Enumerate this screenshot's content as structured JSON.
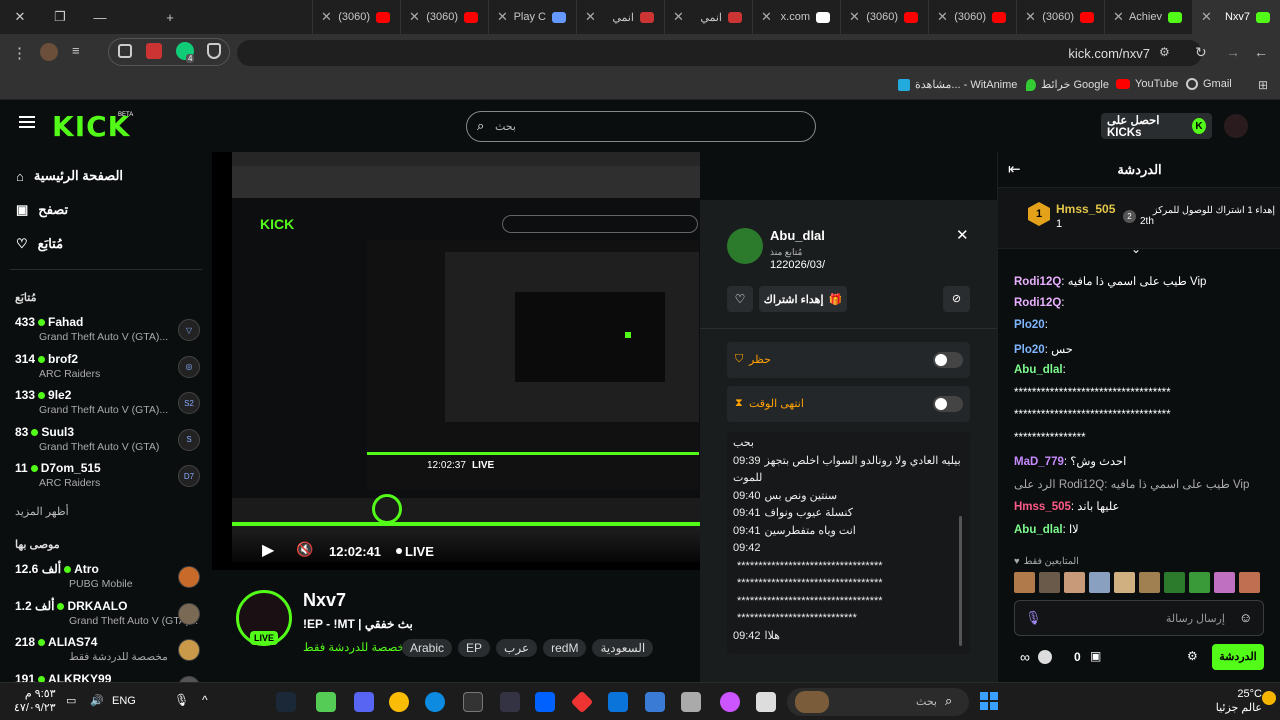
{
  "browser": {
    "tabs": [
      {
        "label": "Nxv7",
        "color": "#53fc18",
        "active": true
      },
      {
        "label": "Achiev",
        "color": "#53fc18"
      },
      {
        "label": "(3060)",
        "color": "#ff0000"
      },
      {
        "label": "(3060)",
        "color": "#ff0000"
      },
      {
        "label": "(3060)",
        "color": "#ff0000"
      },
      {
        "label": "x.com",
        "color": "#ffffff"
      },
      {
        "label": "انمي",
        "color": "#c33"
      },
      {
        "label": "انمي",
        "color": "#c33"
      },
      {
        "label": "Play C",
        "color": "#6699ff"
      },
      {
        "label": "(3060)",
        "color": "#ff0000"
      },
      {
        "label": "(3060)",
        "color": "#ff0000"
      }
    ],
    "url": "kick.com/nxv7",
    "bookmarks": [
      {
        "label": "Gmail",
        "icon": "gmail-icon"
      },
      {
        "label": "YouTube",
        "icon": "youtube-icon"
      },
      {
        "label": "خرائط Google",
        "icon": "maps-icon"
      },
      {
        "label": "مشاهدة... - WitAnime",
        "icon": "witanime-icon"
      }
    ],
    "ext_badge": "4"
  },
  "header": {
    "logo": "KICK",
    "beta": "BETA",
    "search_placeholder": "بحث",
    "get_kicks": "احصل على KICKs"
  },
  "sidebar": {
    "nav": [
      {
        "label": "الصفحة الرئيسية",
        "icon": "home-icon"
      },
      {
        "label": "تصفح",
        "icon": "browse-icon"
      },
      {
        "label": "مُتابَع",
        "icon": "heart-icon"
      }
    ],
    "following_title": "مُتابَع",
    "following": [
      {
        "name": "Fahad",
        "viewers": "433",
        "game": "Grand Theft Auto V (GTA)...",
        "avatar": "▽"
      },
      {
        "name": "brof2",
        "viewers": "314",
        "game": "ARC Raiders",
        "avatar": "◎"
      },
      {
        "name": "9le2",
        "viewers": "133",
        "game": "Grand Theft Auto V (GTA)...",
        "avatar": "S2"
      },
      {
        "name": "Suul3",
        "viewers": "83",
        "game": "Grand Theft Auto V (GTA)",
        "avatar": "S"
      },
      {
        "name": "D7om_515",
        "viewers": "11",
        "game": "ARC Raiders",
        "avatar": "D7"
      }
    ],
    "show_more": "أظهر المزيد",
    "recommended_title": "موصى بها",
    "recommended": [
      {
        "name": "Atro",
        "viewers": "12.6 ألف",
        "game": "PUBG Mobile"
      },
      {
        "name": "DRKAALO",
        "viewers": "1.2 ألف",
        "game": "Grand Theft Auto V (GTA)..."
      },
      {
        "name": "ALIAS74",
        "viewers": "218",
        "game": "مخصصة للدردشة فقط"
      },
      {
        "name": "ALKRKY99",
        "viewers": "191",
        "game": ""
      }
    ]
  },
  "player": {
    "time": "12:02:41",
    "live": "LIVE",
    "inner_time": "12:02:37",
    "inner_live": "LIVE"
  },
  "stream": {
    "name": "Nxv7",
    "title": "!EP - !MT | بث خفقي",
    "category": "مخصصة للدردشة فقط",
    "live_badge": "LIVE",
    "tags": [
      "السعودية",
      "redM",
      "عرب",
      "EP",
      "Arabic"
    ]
  },
  "modal": {
    "username": "Abu_dlal",
    "following_since_label": "مُتابع منذ",
    "following_since": "122026/03/",
    "gift_sub": "إهداء اشتراك",
    "ban_label": "حظر",
    "timeout_label": "انتهى الوقت",
    "messages": [
      {
        "time": "",
        "text": "بحب"
      },
      {
        "time": "09:39",
        "text": "بيليه العادي ولا رونالدو السواب اخلص بتجهز"
      },
      {
        "time": "",
        "text": "للموت"
      },
      {
        "time": "09:40",
        "text": "سنتين ونص بس"
      },
      {
        "time": "09:41",
        "text": "كنسلة عيوب ونواف"
      },
      {
        "time": "09:41",
        "text": "انت وياه متفطرسين"
      },
      {
        "time": "09:42",
        "text": ""
      },
      {
        "time": "",
        "text": "**********************************"
      },
      {
        "time": "",
        "text": "**********************************"
      },
      {
        "time": "",
        "text": "**********************************"
      },
      {
        "time": "",
        "text": "****************************"
      },
      {
        "time": "09:42",
        "text": "هلاا"
      }
    ]
  },
  "chat": {
    "title": "الدردشة",
    "gift_text": "إهداء 1 اشتراك للوصول للمركز",
    "gift_rank": "2th",
    "top_gifter": "Hmss_505",
    "top_count": "1",
    "lines": [
      {
        "user": "Rodi12Q",
        "color": "#e9b0ff",
        "text": "طيب على اسمي ذا مافيه Vip"
      },
      {
        "user": "Rodi12Q",
        "color": "#e9b0ff",
        "text": ""
      },
      {
        "user": "Plo20",
        "color": "#7fb6ff",
        "text": ""
      },
      {
        "user": "Plo20",
        "color": "#7fb6ff",
        "text": "حس"
      },
      {
        "user": "Abu_dlal",
        "color": "#7cfc8e",
        "text": ""
      },
      {
        "user": "",
        "color": "#fff",
        "text": "***********************************"
      },
      {
        "user": "",
        "color": "#fff",
        "text": "***********************************"
      },
      {
        "user": "",
        "color": "#fff",
        "text": "****************"
      },
      {
        "user": "MaD_779",
        "color": "#c88bff",
        "text": "احدث وش؟"
      },
      {
        "user": "",
        "color": "#aaa",
        "text": "الرد على Rodi12Q: طيب على اسمي ذا مافيه Vip"
      },
      {
        "user": "Hmss_505",
        "color": "#ff5b8a",
        "text": "عليها باند"
      },
      {
        "user": "Abu_dlal",
        "color": "#7cfc8e",
        "text": "لاا"
      }
    ],
    "subs_only": "المتابعين فقط",
    "input_placeholder": "إرسال رسالة",
    "send": "الدردشة",
    "points": "0"
  },
  "taskbar": {
    "weather_temp": "25°C",
    "weather_desc": "عالم جزئيا",
    "search_placeholder": "بحث",
    "lang": "ENG",
    "time": "٩:٥٣ م",
    "date": "٤٧/٠٩/٢٣"
  }
}
